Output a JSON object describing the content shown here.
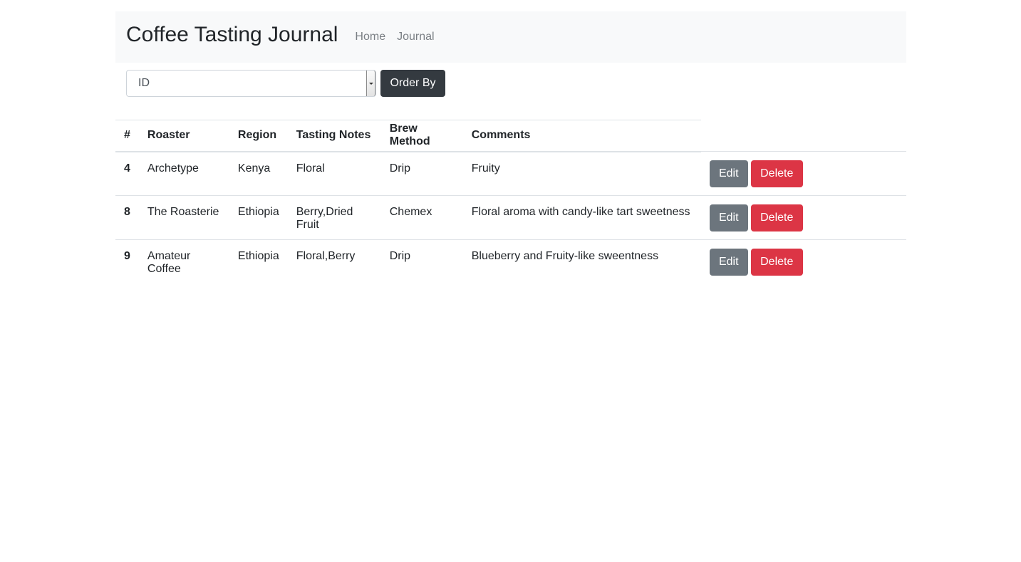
{
  "navbar": {
    "brand": "Coffee Tasting Journal",
    "links": [
      "Home",
      "Journal"
    ]
  },
  "controls": {
    "order_select_value": "ID",
    "order_button_label": "Order By"
  },
  "table": {
    "headers": [
      "#",
      "Roaster",
      "Region",
      "Tasting Notes",
      "Brew Method",
      "Comments"
    ],
    "rows": [
      {
        "id": "4",
        "roaster": "Archetype",
        "region": "Kenya",
        "notes": "Floral",
        "brew": "Drip",
        "comments": "Fruity"
      },
      {
        "id": "8",
        "roaster": "The Roasterie",
        "region": "Ethiopia",
        "notes": "Berry,Dried Fruit",
        "brew": "Chemex",
        "comments": "Floral aroma with candy-like tart sweetness"
      },
      {
        "id": "9",
        "roaster": "Amateur Coffee",
        "region": "Ethiopia",
        "notes": "Floral,Berry",
        "brew": "Drip",
        "comments": "Blueberry and Fruity-like sweentness"
      }
    ],
    "edit_label": "Edit",
    "delete_label": "Delete"
  },
  "colors": {
    "navbar_bg": "#f8f9fa",
    "dark_button": "#343a40",
    "edit_button": "#6c757d",
    "delete_button": "#dc3545"
  }
}
